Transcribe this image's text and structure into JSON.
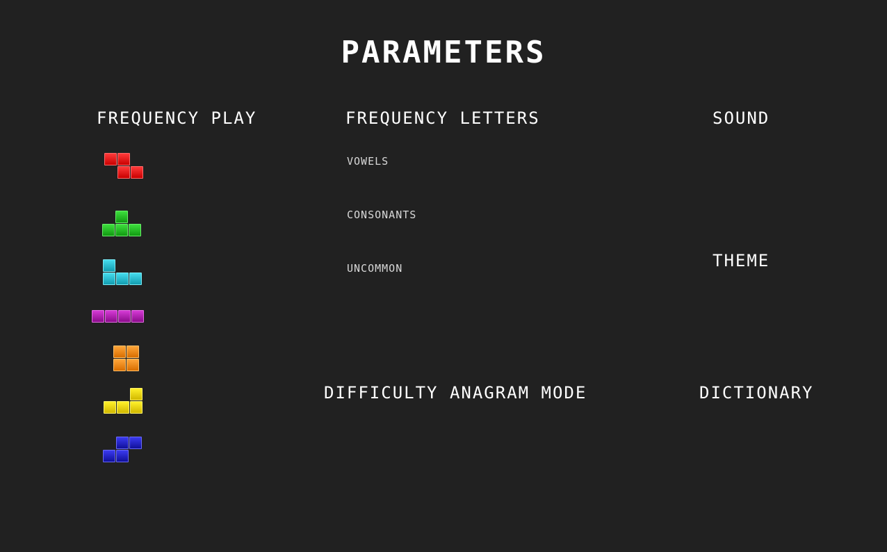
{
  "title": "PARAMETERS",
  "columns": {
    "frequency_play": "FREQUENCY PLAY",
    "frequency_letters": "FREQUENCY LETTERS",
    "sound": "SOUND",
    "theme": "THEME",
    "difficulty": "DIFFICULTY ANAGRAM MODE",
    "dictionary": "DICTIONARY"
  },
  "letters": {
    "vowels": "VOWELS",
    "consonants": "CONSONANTS",
    "uncommon": "UNCOMMON"
  },
  "pieces": [
    {
      "name": "z-piece",
      "color": "#e01515"
    },
    {
      "name": "t-piece",
      "color": "#22c022"
    },
    {
      "name": "j-piece",
      "color": "#2ec3d6"
    },
    {
      "name": "i-piece",
      "color": "#b420b4"
    },
    {
      "name": "o-piece",
      "color": "#f08a10"
    },
    {
      "name": "l-piece",
      "color": "#eed510"
    },
    {
      "name": "s-piece",
      "color": "#2222cc"
    }
  ]
}
